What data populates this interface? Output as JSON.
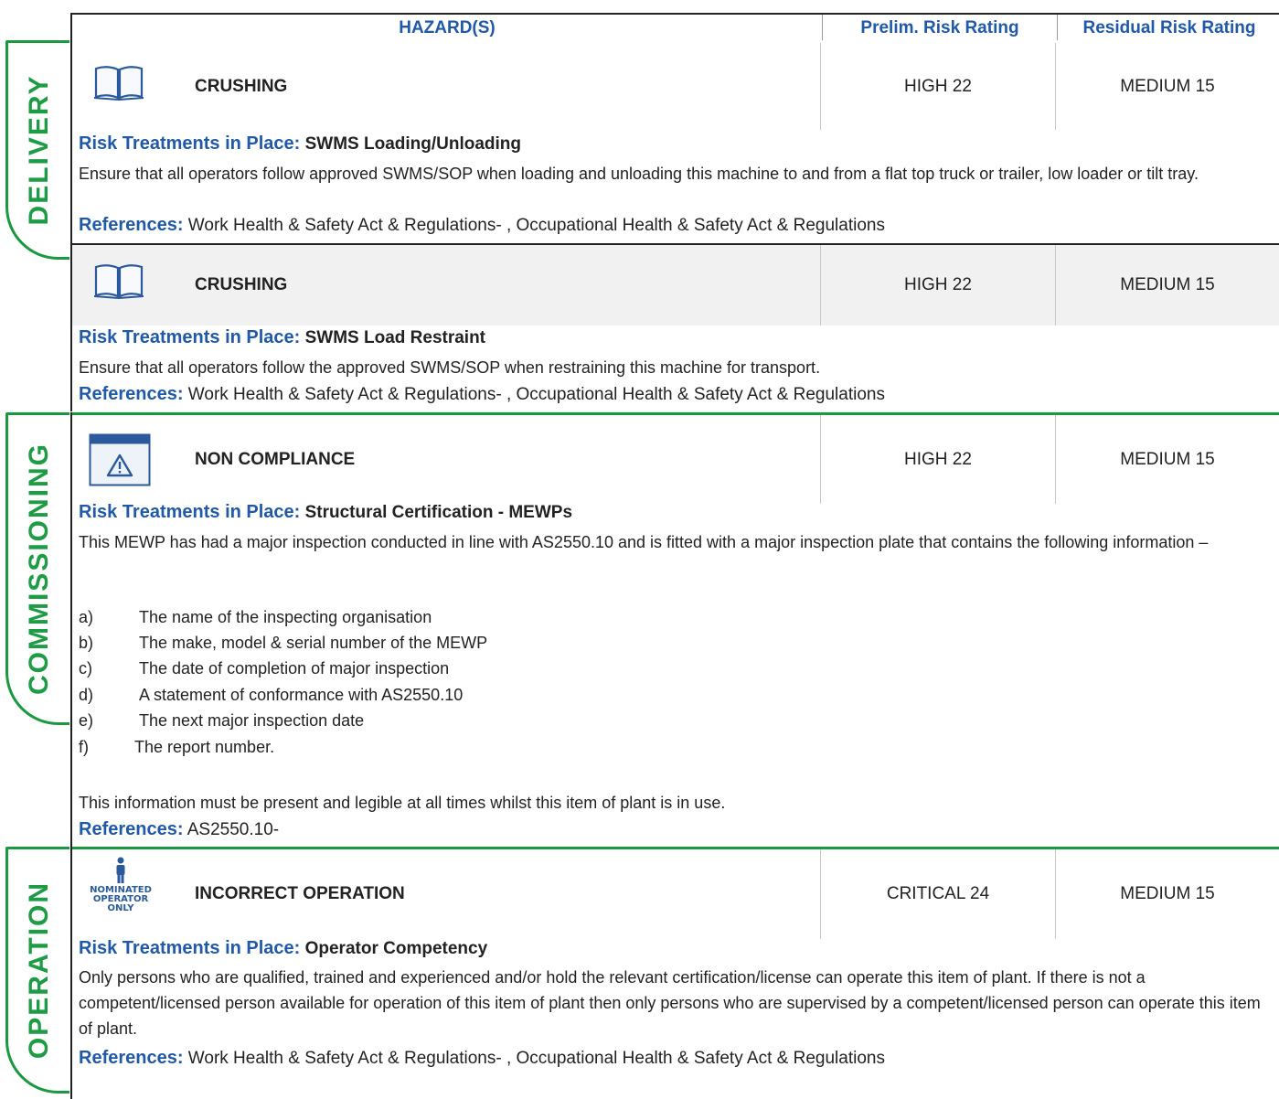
{
  "header": {
    "hazards": "HAZARD(S)",
    "prelim": "Prelim. Risk Rating",
    "residual": "Residual Risk Rating"
  },
  "sections": {
    "delivery": "DELIVERY",
    "commissioning": "COMMISSIONING",
    "operation": "OPERATION"
  },
  "labels": {
    "risk_treatments": "Risk Treatments in Place:",
    "references": "References:"
  },
  "hazards": [
    {
      "icon": "manual-book-icon",
      "name": "CRUSHING",
      "prelim": "HIGH 22",
      "residual": "MEDIUM 15",
      "treatment": "SWMS Loading/Unloading",
      "text": "Ensure that all operators follow approved SWMS/SOP when loading and unloading this machine to and from a flat top truck or trailer, low loader or tilt tray.",
      "references": "Work Health & Safety Act & Regulations- , Occupational Health & Safety Act & Regulations"
    },
    {
      "icon": "manual-book-icon",
      "name": "CRUSHING",
      "prelim": "HIGH 22",
      "residual": "MEDIUM 15",
      "treatment": "SWMS Load Restraint",
      "text": "Ensure that all operators follow the approved SWMS/SOP when restraining this machine for transport.",
      "references": "Work Health & Safety Act & Regulations- , Occupational Health & Safety Act & Regulations"
    },
    {
      "icon": "warning-window-icon",
      "name": "NON COMPLIANCE",
      "prelim": "HIGH 22",
      "residual": "MEDIUM 15",
      "treatment": "Structural Certification - MEWPs",
      "text": "This MEWP has had a major inspection conducted in line with AS2550.10 and is fitted with a major inspection plate that contains the following information –",
      "list": [
        {
          "key": "a)",
          "text": "The name of the inspecting organisation"
        },
        {
          "key": "b)",
          "text": "The make, model & serial number of the MEWP"
        },
        {
          "key": "c)",
          "text": "The date of completion of major inspection"
        },
        {
          "key": "d)",
          "text": "A statement of conformance with AS2550.10"
        },
        {
          "key": "e)",
          "text": "The next major inspection date"
        },
        {
          "key": "f)",
          "text": "The report number."
        }
      ],
      "closing": "This information must be present and legible at all times whilst this item of plant is in use.",
      "references": "AS2550.10-"
    },
    {
      "icon": "nominated-operator-icon",
      "icon_text": [
        "NOMINATED",
        "OPERATOR",
        "ONLY"
      ],
      "name": "INCORRECT OPERATION",
      "prelim": "CRITICAL 24",
      "residual": "MEDIUM 15",
      "treatment": "Operator Competency",
      "text": "Only persons who are qualified, trained and experienced and/or hold the relevant certification/license can operate this item of plant. If there is not a competent/licensed person available for operation of this item of plant then only persons who are supervised by a competent/licensed person can operate this item of plant.",
      "references": "Work Health & Safety Act & Regulations- , Occupational Health & Safety Act & Regulations"
    }
  ],
  "colors": {
    "accent_blue": "#2059a8",
    "section_green": "#1e9b45",
    "row_grey": "#f1f1f1"
  }
}
